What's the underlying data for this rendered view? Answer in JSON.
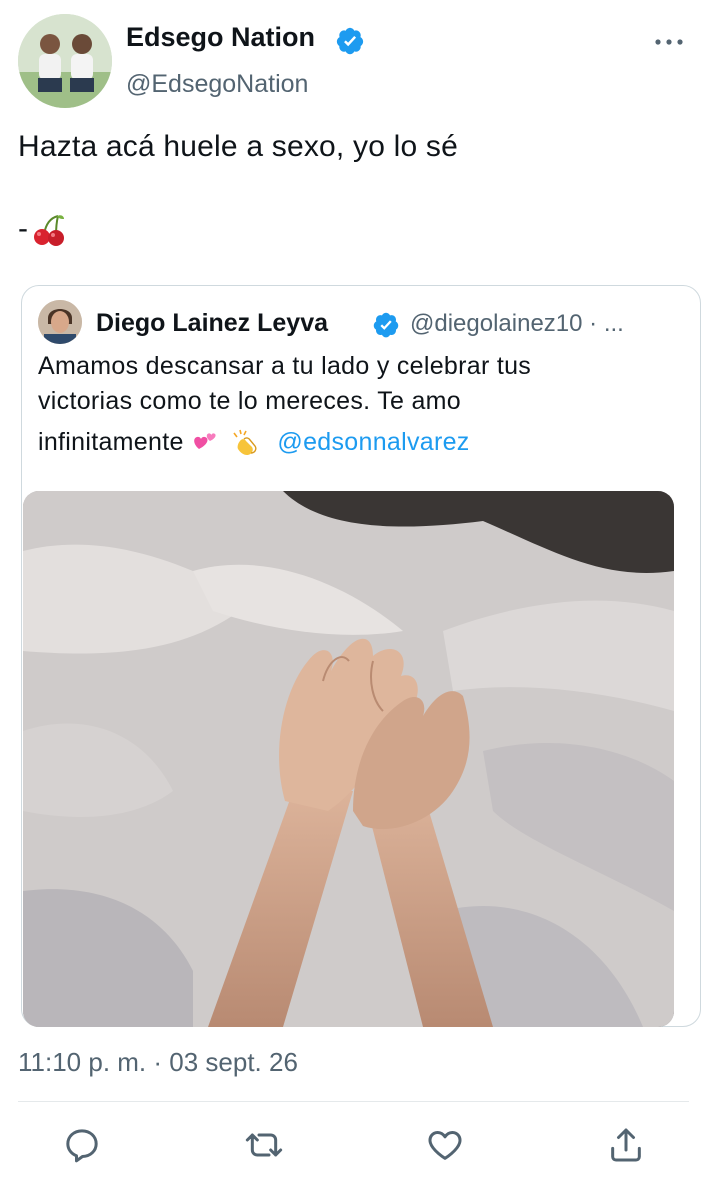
{
  "author": {
    "display_name": "Edsego Nation",
    "handle": "@EdsegoNation",
    "verified": true,
    "avatar_icon": "avatar-two-players-photo"
  },
  "tweet": {
    "text": "Hazta acá huele a sexo, yo lo sé",
    "second_line": "-",
    "emoji": "cherries"
  },
  "quote": {
    "display_name": "Diego Lainez Leyva",
    "handle": "@diegolainez10",
    "more": "· ...",
    "verified": true,
    "line1": "Amamos descansar a tu lado y celebrar tus",
    "line2": "victorias como te lo mereces. Te amo",
    "line3_prefix": "infinitamente",
    "line3_emojis": [
      "two-hearts",
      "clapping-hands"
    ],
    "mention": "@edsonnalvarez",
    "photo": "hands-holding-on-white-sheets"
  },
  "meta": {
    "timestamp": "11:10 p. m. · 03 sept. 26"
  },
  "actions": {
    "icons": [
      "reply-icon",
      "retweet-icon",
      "like-icon",
      "share-icon"
    ]
  },
  "colors": {
    "accent": "#1d9bf0",
    "text": "#0f1419",
    "muted": "#536471",
    "border": "#cfd9de"
  }
}
